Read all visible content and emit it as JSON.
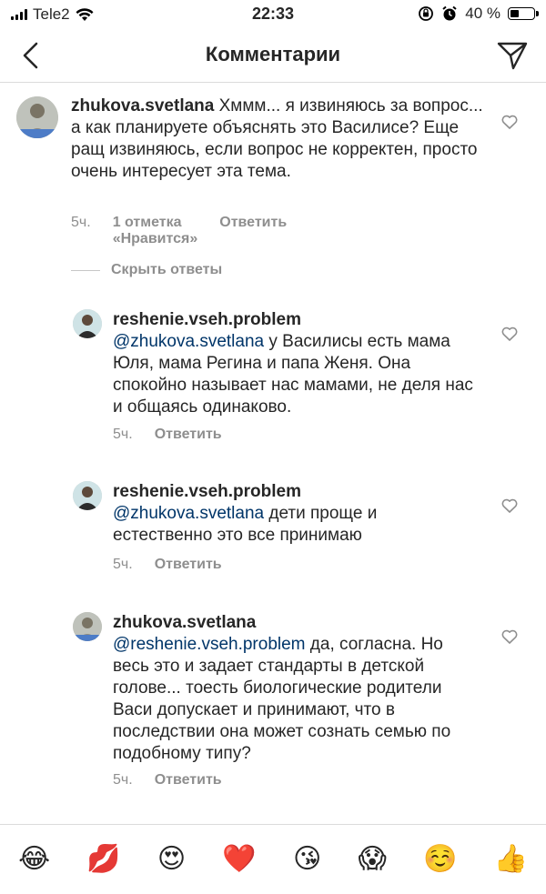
{
  "status_bar": {
    "carrier": "Tele2",
    "time": "22:33",
    "battery": "40 %",
    "battery_level": 0.4
  },
  "header": {
    "title": "Комментарии"
  },
  "comments": [
    {
      "username": "zhukova.svetlana",
      "text": " Хммм... я извиняюсь за вопрос... а как планируете объяснять это Василисе? Еще ращ извиняюсь, если вопрос не корректен, просто очень интересует эта тема.",
      "time": "5ч.",
      "likes": "1 отметка «Нравится»",
      "reply": "Ответить"
    }
  ],
  "hide_replies": "Скрыть ответы",
  "replies": [
    {
      "username": "reshenie.vseh.problem",
      "mention": "@zhukova.svetlana",
      "text": " у Василисы есть мама Юля, мама Регина и папа Женя. Она спокойно называет нас мамами, не деля нас и общаясь одинаково.",
      "time": "5ч.",
      "reply": "Ответить"
    },
    {
      "username": "reshenie.vseh.problem",
      "mention": "@zhukova.svetlana",
      "text": " дети проще и естественно это все принимаю",
      "time": "5ч.",
      "reply": "Ответить"
    },
    {
      "username": "zhukova.svetlana",
      "mention": "@reshenie.vseh.problem",
      "text": " да, согласна. Но весь это и задает стандарты в детской голове... тоесть биологические родители Васи допускает и принимают, что в последствии она может сознать семью по подобному типу?",
      "time": "5ч.",
      "reply": "Ответить"
    }
  ],
  "emoji_bar": [
    "😂",
    "💋",
    "😍",
    "❤️",
    "😘",
    "😱",
    "☺️",
    "👍"
  ]
}
